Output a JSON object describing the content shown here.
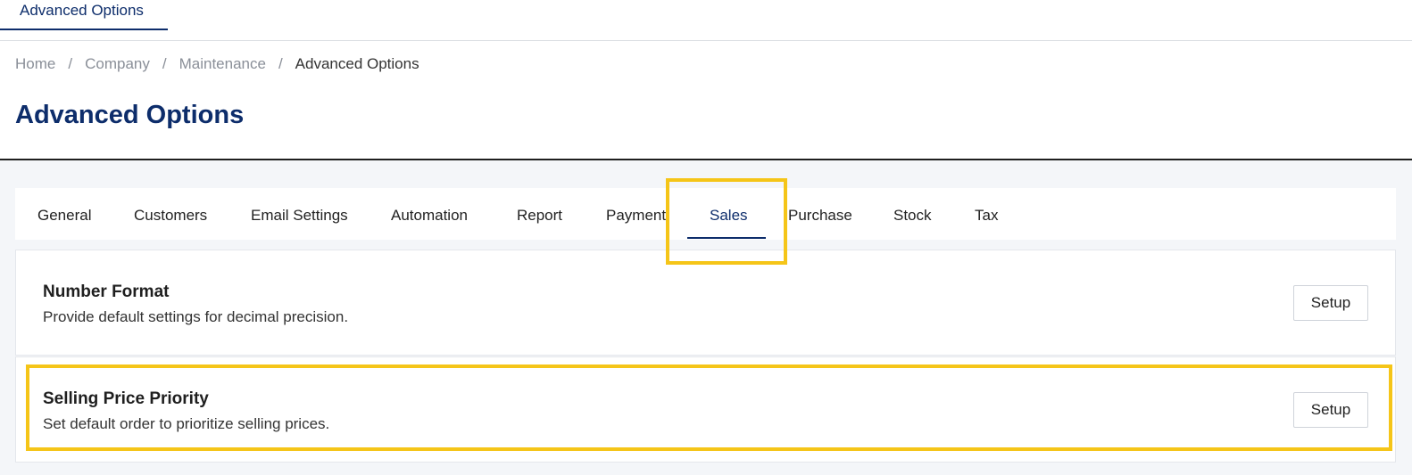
{
  "window_tab": {
    "label": "Advanced Options"
  },
  "breadcrumb": {
    "items": [
      "Home",
      "Company",
      "Maintenance"
    ],
    "current": "Advanced Options",
    "separator": "/"
  },
  "page": {
    "title": "Advanced Options"
  },
  "tabs": [
    {
      "label": "General"
    },
    {
      "label": "Customers"
    },
    {
      "label": "Email Settings"
    },
    {
      "label": "Automation"
    },
    {
      "label": "Report"
    },
    {
      "label": "Payment"
    },
    {
      "label": "Sales",
      "active": true
    },
    {
      "label": "Purchase"
    },
    {
      "label": "Stock"
    },
    {
      "label": "Tax"
    }
  ],
  "cards": [
    {
      "title": "Number Format",
      "description": "Provide default settings for decimal precision.",
      "button": "Setup"
    },
    {
      "title": "Selling Price Priority",
      "description": "Set default order to prioritize selling prices.",
      "button": "Setup"
    }
  ],
  "colors": {
    "brand_navy": "#0d2d6b",
    "highlight": "#f5c518"
  }
}
